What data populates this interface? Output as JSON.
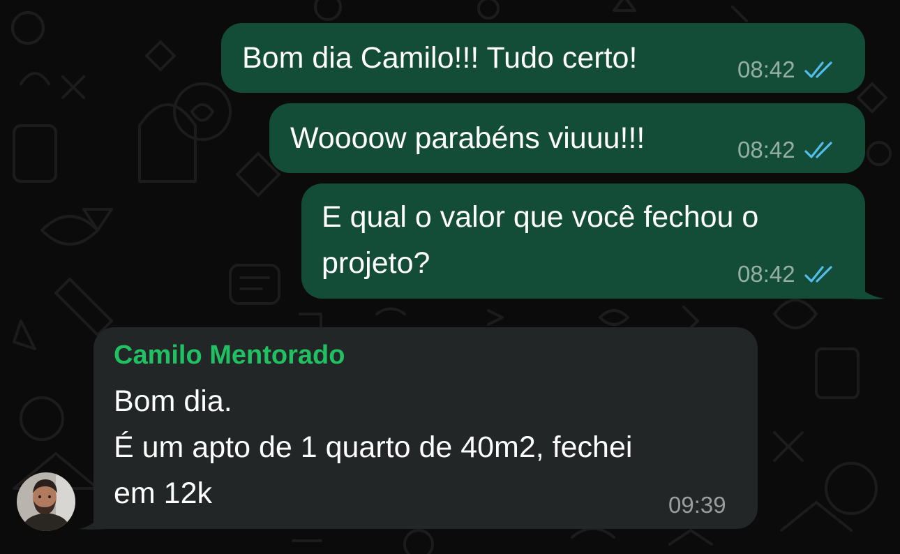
{
  "colors": {
    "background": "#0b0b0b",
    "outgoing_bubble": "#144d37",
    "incoming_bubble": "#232626",
    "sender_name": "#21c063",
    "read_ticks": "#53bdeb"
  },
  "messages": [
    {
      "direction": "outgoing",
      "lines": [
        "Bom dia Camilo!!! Tudo certo!"
      ],
      "time": "08:42",
      "status_icon": "double-check-read-icon"
    },
    {
      "direction": "outgoing",
      "lines": [
        "Woooow parabéns viuuu!!!"
      ],
      "time": "08:42",
      "status_icon": "double-check-read-icon"
    },
    {
      "direction": "outgoing",
      "lines": [
        "E qual o valor que você fechou o",
        "projeto?"
      ],
      "time": "08:42",
      "status_icon": "double-check-read-icon"
    },
    {
      "direction": "incoming",
      "sender": "Camilo Mentorado",
      "lines": [
        "Bom dia.",
        "É um apto de 1 quarto de 40m2, fechei",
        "em 12k"
      ],
      "time": "09:39",
      "avatar_icon": "contact-avatar"
    }
  ]
}
